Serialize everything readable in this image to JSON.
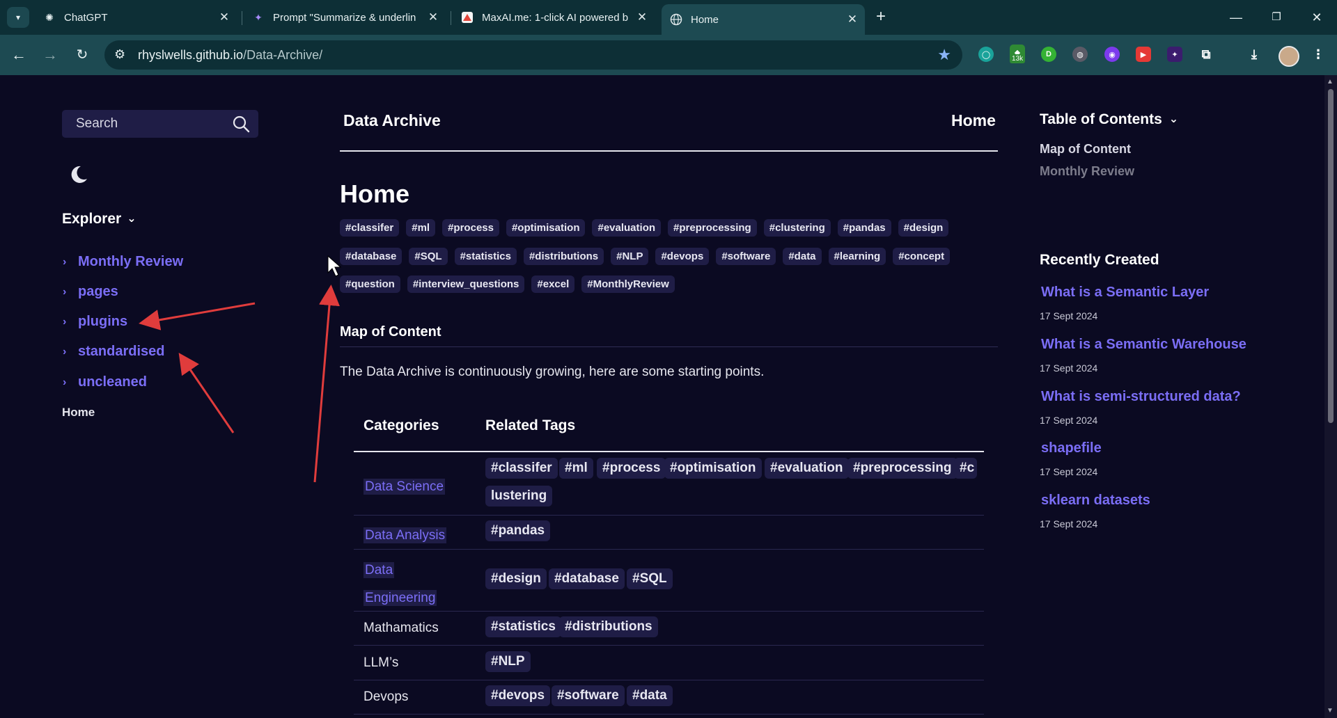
{
  "browser": {
    "tabs": [
      {
        "title": "ChatGPT",
        "icon": "chatgpt-icon",
        "active": false
      },
      {
        "title": "Prompt \"Summarize & underlin",
        "icon": "sparkle-icon",
        "active": false
      },
      {
        "title": "MaxAI.me: 1-click AI powered b",
        "icon": "maxai-icon",
        "active": false
      },
      {
        "title": "Home",
        "icon": "globe-icon",
        "active": true
      }
    ],
    "url_host": "rhyslwells.github.io",
    "url_path": "/Data-Archive/",
    "extension_badge": "13k"
  },
  "sidebar": {
    "search_label": "Search",
    "explorer_title": "Explorer",
    "folders": [
      "Monthly Review",
      "pages",
      "plugins",
      "standardised",
      "uncleaned"
    ],
    "home_label": "Home"
  },
  "header": {
    "site_title": "Data Archive",
    "breadcrumb": "Home"
  },
  "main": {
    "page_title": "Home",
    "tag_rows": [
      [
        "#classifer",
        "#ml",
        "#process",
        "#optimisation",
        "#evaluation",
        "#preprocessing",
        "#clustering",
        "#pandas",
        "#design"
      ],
      [
        "#database",
        "#SQL",
        "#statistics",
        "#distributions",
        "#NLP",
        "#devops",
        "#software",
        "#data",
        "#learning",
        "#concept"
      ],
      [
        "#question",
        "#interview_questions",
        "#excel",
        "#MonthlyReview"
      ]
    ],
    "section_heading": "Map of Content",
    "intro": "The Data Archive is continuously growing, here are some starting points.",
    "table": {
      "headers": [
        "Categories",
        "Related Tags"
      ],
      "rows": [
        {
          "category": "Data Science",
          "link": true,
          "tags": [
            "#classifer",
            "#ml",
            "#process",
            "#optimisation",
            "#evaluation",
            "#preprocessing",
            "#c",
            "lustering"
          ]
        },
        {
          "category": "Data Analysis",
          "link": true,
          "tags": [
            "#pandas"
          ]
        },
        {
          "category_line1": "Data",
          "category_line2": "Engineering",
          "link": true,
          "tags": [
            "#design",
            "#database",
            "#SQL"
          ]
        },
        {
          "category": "Mathamatics",
          "link": false,
          "tags": [
            "#statistics",
            "#distributions"
          ]
        },
        {
          "category": "LLM’s",
          "link": false,
          "tags": [
            "#NLP"
          ]
        },
        {
          "category": "Devops",
          "link": false,
          "tags": [
            "#devops",
            "#software",
            "#data"
          ]
        }
      ]
    }
  },
  "toc": {
    "title": "Table of Contents",
    "items": [
      "Map of Content",
      "Monthly Review"
    ]
  },
  "recent": {
    "title": "Recently Created",
    "items": [
      {
        "title": "What is a Semantic Layer",
        "date": "17 Sept 2024"
      },
      {
        "title": "What is a Semantic Warehouse",
        "date": "17 Sept 2024"
      },
      {
        "title": "What is semi-structured data?",
        "date": "17 Sept 2024"
      },
      {
        "title": "shapefile",
        "date": "17 Sept 2024"
      },
      {
        "title": "sklearn datasets",
        "date": "17 Sept 2024"
      }
    ]
  },
  "colors": {
    "background": "#0b0a22",
    "accent": "#7b6ef6",
    "tag_bg": "#1f1d46",
    "annotation_arrow": "#e03c3c",
    "chrome": "#1d4a52"
  }
}
